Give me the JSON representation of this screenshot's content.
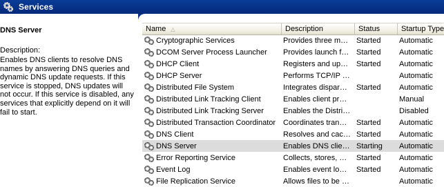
{
  "window": {
    "title": "Services",
    "icon": "services-gear-icon"
  },
  "detail": {
    "service_name": "DNS Server",
    "description_label": "Description:",
    "description_text": "Enables DNS clients to resolve DNS names by answering DNS queries and dynamic DNS update requests. If this service is stopped, DNS updates will not occur. If this service is disabled, any services that explicitly depend on it will fail to start."
  },
  "columns": {
    "name": "Name",
    "description": "Description",
    "status": "Status",
    "startup_type": "Startup Type"
  },
  "sort": {
    "column": "name",
    "indicator": "△"
  },
  "services": [
    {
      "name": "Cryptographic Services",
      "description": "Provides three m…",
      "status": "Started",
      "startup": "Automatic"
    },
    {
      "name": "DCOM Server Process Launcher",
      "description": "Provides launch f…",
      "status": "Started",
      "startup": "Automatic"
    },
    {
      "name": "DHCP Client",
      "description": "Registers and up…",
      "status": "Started",
      "startup": "Automatic"
    },
    {
      "name": "DHCP Server",
      "description": "Performs TCP/IP …",
      "status": "",
      "startup": "Automatic"
    },
    {
      "name": "Distributed File System",
      "description": "Integrates dispar…",
      "status": "Started",
      "startup": "Automatic"
    },
    {
      "name": "Distributed Link Tracking Client",
      "description": "Enables client pr…",
      "status": "",
      "startup": "Manual"
    },
    {
      "name": "Distributed Link Tracking Server",
      "description": "Enables the Distri…",
      "status": "",
      "startup": "Disabled"
    },
    {
      "name": "Distributed Transaction Coordinator",
      "description": "Coordinates tran…",
      "status": "Started",
      "startup": "Automatic"
    },
    {
      "name": "DNS Client",
      "description": "Resolves and cac…",
      "status": "Started",
      "startup": "Automatic"
    },
    {
      "name": "DNS Server",
      "description": "Enables DNS clie…",
      "status": "Starting",
      "startup": "Automatic",
      "selected": true
    },
    {
      "name": "Error Reporting Service",
      "description": "Collects, stores, …",
      "status": "Started",
      "startup": "Automatic"
    },
    {
      "name": "Event Log",
      "description": "Enables event lo…",
      "status": "Started",
      "startup": "Automatic"
    },
    {
      "name": "File Replication Service",
      "description": "Allows files to be …",
      "status": "",
      "startup": "Automatic"
    }
  ],
  "colors": {
    "title_bar": "#073189",
    "selected_row": "#dcdcdc"
  }
}
